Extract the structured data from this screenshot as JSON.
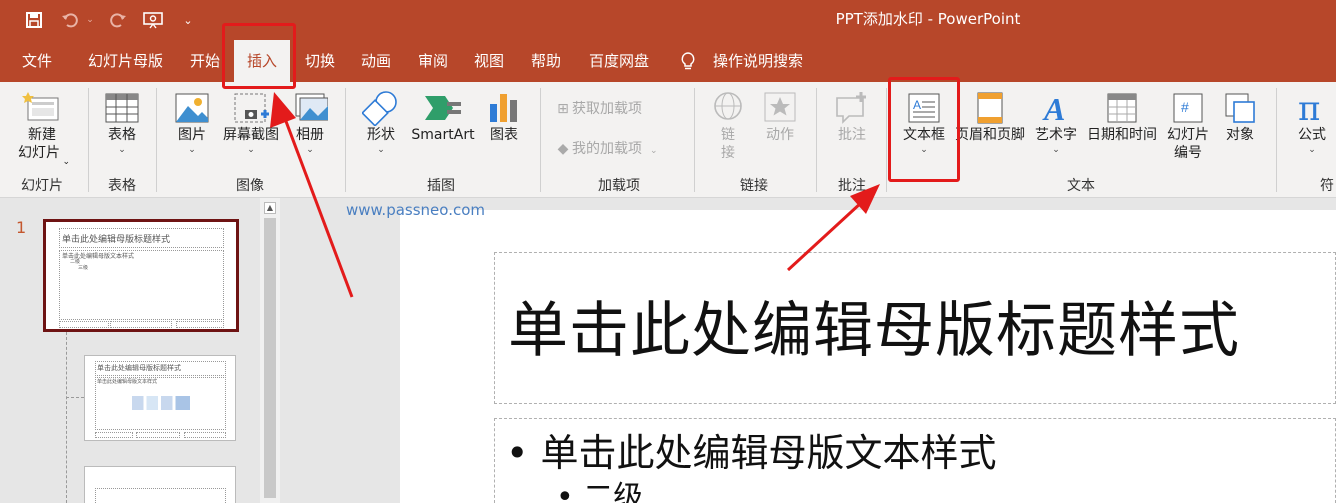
{
  "window": {
    "title": "PPT添加水印 - PowerPoint"
  },
  "quick_access": {
    "save_icon": "save-icon",
    "undo_icon": "undo-icon",
    "redo_icon": "redo-icon",
    "present_icon": "present-icon",
    "customize_icon": "customize-icon"
  },
  "tabs": [
    {
      "label": "文件"
    },
    {
      "label": "幻灯片母版"
    },
    {
      "label": "开始"
    },
    {
      "label": "插入"
    },
    {
      "label": "切换"
    },
    {
      "label": "动画"
    },
    {
      "label": "审阅"
    },
    {
      "label": "视图"
    },
    {
      "label": "帮助"
    },
    {
      "label": "百度网盘"
    },
    {
      "label": "操作说明搜索"
    }
  ],
  "active_tab": "插入",
  "ribbon": {
    "slides": {
      "new_slide_l1": "新建",
      "new_slide_l2": "幻灯片",
      "group": "幻灯片"
    },
    "tables": {
      "table": "表格",
      "group": "表格"
    },
    "images": {
      "picture": "图片",
      "screenshot": "屏幕截图",
      "album": "相册",
      "group": "图像"
    },
    "illustrations": {
      "shapes": "形状",
      "smartart": "SmartArt",
      "chart": "图表",
      "group": "插图"
    },
    "addins": {
      "get": "获取加载项",
      "mine": "我的加载项",
      "group": "加载项"
    },
    "links": {
      "link_l1": "链",
      "link_l2": "接",
      "action": "动作",
      "group": "链接"
    },
    "comments": {
      "comment": "批注",
      "group": "批注"
    },
    "text": {
      "textbox": "文本框",
      "header_footer": "页眉和页脚",
      "wordart": "艺术字",
      "datetime": "日期和时间",
      "slide_num_l1": "幻灯片",
      "slide_num_l2": "编号",
      "object": "对象",
      "group": "文本"
    },
    "symbols": {
      "equation": "公式",
      "group_partial": "符"
    }
  },
  "thumbnails": {
    "slide_number": "1",
    "master_title": "单击此处编辑母版标题样式",
    "master_body": "单击此处编辑母版文本样式",
    "level2": "二级",
    "level3": "三级",
    "layout_title": "单击此处编辑母版标题样式",
    "layout_body": "单击此处编辑母版文本样式"
  },
  "watermark": "www.passneo.com",
  "slide": {
    "title": "单击此处编辑母版标题样式",
    "body_l1": "• 单击此处编辑母版文本样式",
    "body_l2": "• 二级"
  },
  "colors": {
    "accent": "#b7472a",
    "annotation": "#e31b1b",
    "watermark": "#4a7fc1"
  }
}
